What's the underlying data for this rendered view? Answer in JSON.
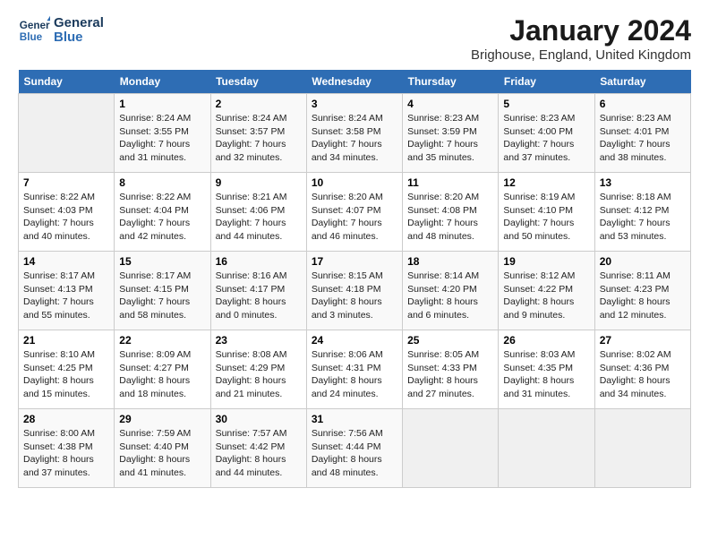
{
  "logo": {
    "line1": "General",
    "line2": "Blue"
  },
  "title": "January 2024",
  "location": "Brighouse, England, United Kingdom",
  "days_header": [
    "Sunday",
    "Monday",
    "Tuesday",
    "Wednesday",
    "Thursday",
    "Friday",
    "Saturday"
  ],
  "weeks": [
    [
      {
        "day": "",
        "content": ""
      },
      {
        "day": "1",
        "content": "Sunrise: 8:24 AM\nSunset: 3:55 PM\nDaylight: 7 hours\nand 31 minutes."
      },
      {
        "day": "2",
        "content": "Sunrise: 8:24 AM\nSunset: 3:57 PM\nDaylight: 7 hours\nand 32 minutes."
      },
      {
        "day": "3",
        "content": "Sunrise: 8:24 AM\nSunset: 3:58 PM\nDaylight: 7 hours\nand 34 minutes."
      },
      {
        "day": "4",
        "content": "Sunrise: 8:23 AM\nSunset: 3:59 PM\nDaylight: 7 hours\nand 35 minutes."
      },
      {
        "day": "5",
        "content": "Sunrise: 8:23 AM\nSunset: 4:00 PM\nDaylight: 7 hours\nand 37 minutes."
      },
      {
        "day": "6",
        "content": "Sunrise: 8:23 AM\nSunset: 4:01 PM\nDaylight: 7 hours\nand 38 minutes."
      }
    ],
    [
      {
        "day": "7",
        "content": "Sunrise: 8:22 AM\nSunset: 4:03 PM\nDaylight: 7 hours\nand 40 minutes."
      },
      {
        "day": "8",
        "content": "Sunrise: 8:22 AM\nSunset: 4:04 PM\nDaylight: 7 hours\nand 42 minutes."
      },
      {
        "day": "9",
        "content": "Sunrise: 8:21 AM\nSunset: 4:06 PM\nDaylight: 7 hours\nand 44 minutes."
      },
      {
        "day": "10",
        "content": "Sunrise: 8:20 AM\nSunset: 4:07 PM\nDaylight: 7 hours\nand 46 minutes."
      },
      {
        "day": "11",
        "content": "Sunrise: 8:20 AM\nSunset: 4:08 PM\nDaylight: 7 hours\nand 48 minutes."
      },
      {
        "day": "12",
        "content": "Sunrise: 8:19 AM\nSunset: 4:10 PM\nDaylight: 7 hours\nand 50 minutes."
      },
      {
        "day": "13",
        "content": "Sunrise: 8:18 AM\nSunset: 4:12 PM\nDaylight: 7 hours\nand 53 minutes."
      }
    ],
    [
      {
        "day": "14",
        "content": "Sunrise: 8:17 AM\nSunset: 4:13 PM\nDaylight: 7 hours\nand 55 minutes."
      },
      {
        "day": "15",
        "content": "Sunrise: 8:17 AM\nSunset: 4:15 PM\nDaylight: 7 hours\nand 58 minutes."
      },
      {
        "day": "16",
        "content": "Sunrise: 8:16 AM\nSunset: 4:17 PM\nDaylight: 8 hours\nand 0 minutes."
      },
      {
        "day": "17",
        "content": "Sunrise: 8:15 AM\nSunset: 4:18 PM\nDaylight: 8 hours\nand 3 minutes."
      },
      {
        "day": "18",
        "content": "Sunrise: 8:14 AM\nSunset: 4:20 PM\nDaylight: 8 hours\nand 6 minutes."
      },
      {
        "day": "19",
        "content": "Sunrise: 8:12 AM\nSunset: 4:22 PM\nDaylight: 8 hours\nand 9 minutes."
      },
      {
        "day": "20",
        "content": "Sunrise: 8:11 AM\nSunset: 4:23 PM\nDaylight: 8 hours\nand 12 minutes."
      }
    ],
    [
      {
        "day": "21",
        "content": "Sunrise: 8:10 AM\nSunset: 4:25 PM\nDaylight: 8 hours\nand 15 minutes."
      },
      {
        "day": "22",
        "content": "Sunrise: 8:09 AM\nSunset: 4:27 PM\nDaylight: 8 hours\nand 18 minutes."
      },
      {
        "day": "23",
        "content": "Sunrise: 8:08 AM\nSunset: 4:29 PM\nDaylight: 8 hours\nand 21 minutes."
      },
      {
        "day": "24",
        "content": "Sunrise: 8:06 AM\nSunset: 4:31 PM\nDaylight: 8 hours\nand 24 minutes."
      },
      {
        "day": "25",
        "content": "Sunrise: 8:05 AM\nSunset: 4:33 PM\nDaylight: 8 hours\nand 27 minutes."
      },
      {
        "day": "26",
        "content": "Sunrise: 8:03 AM\nSunset: 4:35 PM\nDaylight: 8 hours\nand 31 minutes."
      },
      {
        "day": "27",
        "content": "Sunrise: 8:02 AM\nSunset: 4:36 PM\nDaylight: 8 hours\nand 34 minutes."
      }
    ],
    [
      {
        "day": "28",
        "content": "Sunrise: 8:00 AM\nSunset: 4:38 PM\nDaylight: 8 hours\nand 37 minutes."
      },
      {
        "day": "29",
        "content": "Sunrise: 7:59 AM\nSunset: 4:40 PM\nDaylight: 8 hours\nand 41 minutes."
      },
      {
        "day": "30",
        "content": "Sunrise: 7:57 AM\nSunset: 4:42 PM\nDaylight: 8 hours\nand 44 minutes."
      },
      {
        "day": "31",
        "content": "Sunrise: 7:56 AM\nSunset: 4:44 PM\nDaylight: 8 hours\nand 48 minutes."
      },
      {
        "day": "",
        "content": ""
      },
      {
        "day": "",
        "content": ""
      },
      {
        "day": "",
        "content": ""
      }
    ]
  ]
}
